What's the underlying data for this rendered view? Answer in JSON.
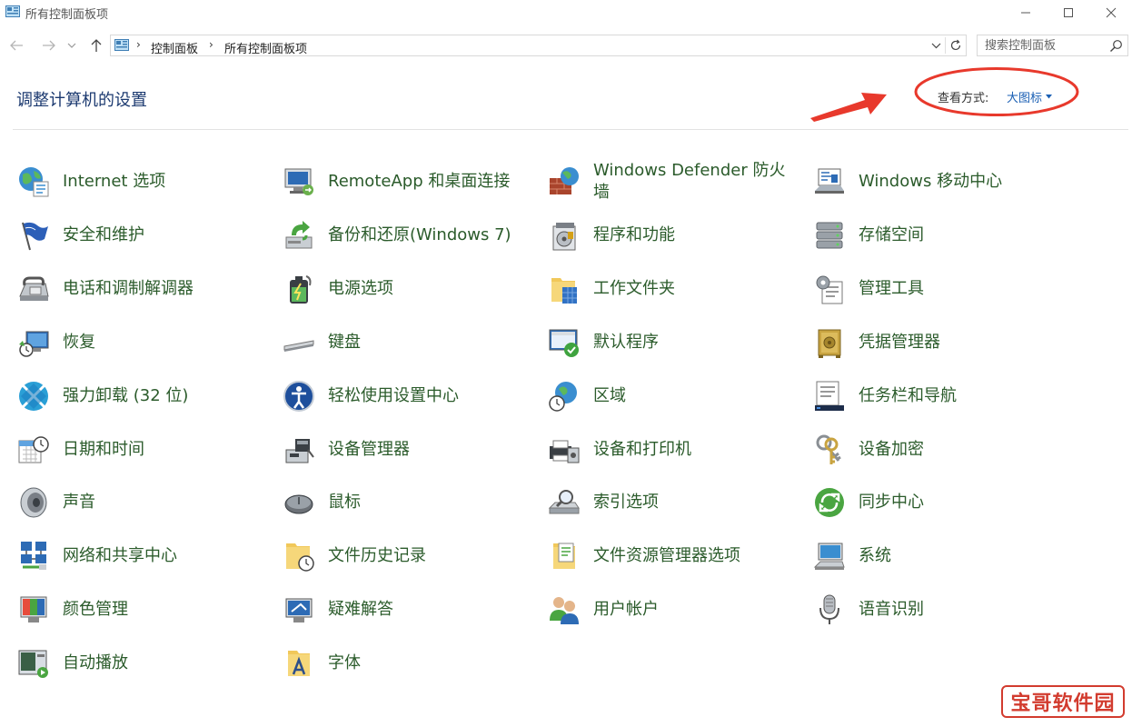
{
  "window": {
    "title": "所有控制面板项",
    "minimize_icon": "minimize-icon",
    "maximize_icon": "maximize-icon",
    "close_icon": "close-icon"
  },
  "nav": {
    "back_icon": "arrow-left-icon",
    "forward_icon": "arrow-right-icon",
    "recent_icon": "chevron-down-icon",
    "up_icon": "arrow-up-icon"
  },
  "address": {
    "location_icon": "control-panel-icon",
    "breadcrumbs": [
      "控制面板",
      "所有控制面板项"
    ],
    "refresh_icon": "refresh-icon"
  },
  "search": {
    "placeholder": "搜索控制面板",
    "icon": "search-icon"
  },
  "header": {
    "title": "调整计算机的设置",
    "view_by_label": "查看方式:",
    "view_by_value": "大图标"
  },
  "annotation": {
    "color": "#e8392c"
  },
  "colors": {
    "link_green": "#2b5b2b",
    "title_blue": "#1c3a70",
    "accent_blue": "#1a5fb4"
  },
  "items": [
    {
      "label": "Internet 选项",
      "icon": "globe-icon"
    },
    {
      "label": "RemoteApp 和桌面连接",
      "icon": "remote-desktop-icon"
    },
    {
      "label": "Windows Defender 防火墙",
      "icon": "firewall-icon"
    },
    {
      "label": "Windows 移动中心",
      "icon": "mobility-center-icon"
    },
    {
      "label": "安全和维护",
      "icon": "flag-icon"
    },
    {
      "label": "备份和还原(Windows 7)",
      "icon": "backup-icon"
    },
    {
      "label": "程序和功能",
      "icon": "programs-icon"
    },
    {
      "label": "存储空间",
      "icon": "storage-icon"
    },
    {
      "label": "电话和调制解调器",
      "icon": "phone-modem-icon"
    },
    {
      "label": "电源选项",
      "icon": "battery-icon"
    },
    {
      "label": "工作文件夹",
      "icon": "work-folders-icon"
    },
    {
      "label": "管理工具",
      "icon": "admin-tools-icon"
    },
    {
      "label": "恢复",
      "icon": "recovery-icon"
    },
    {
      "label": "键盘",
      "icon": "keyboard-icon"
    },
    {
      "label": "默认程序",
      "icon": "default-programs-icon"
    },
    {
      "label": "凭据管理器",
      "icon": "credential-vault-icon"
    },
    {
      "label": "强力卸载 (32 位)",
      "icon": "uninstaller-icon"
    },
    {
      "label": "轻松使用设置中心",
      "icon": "ease-of-access-icon"
    },
    {
      "label": "区域",
      "icon": "region-icon"
    },
    {
      "label": "任务栏和导航",
      "icon": "taskbar-icon"
    },
    {
      "label": "日期和时间",
      "icon": "calendar-clock-icon"
    },
    {
      "label": "设备管理器",
      "icon": "device-manager-icon"
    },
    {
      "label": "设备和打印机",
      "icon": "printer-icon"
    },
    {
      "label": "设备加密",
      "icon": "keys-icon"
    },
    {
      "label": "声音",
      "icon": "speaker-icon"
    },
    {
      "label": "鼠标",
      "icon": "mouse-icon"
    },
    {
      "label": "索引选项",
      "icon": "indexing-icon"
    },
    {
      "label": "同步中心",
      "icon": "sync-icon"
    },
    {
      "label": "网络和共享中心",
      "icon": "network-icon"
    },
    {
      "label": "文件历史记录",
      "icon": "file-history-icon"
    },
    {
      "label": "文件资源管理器选项",
      "icon": "folder-options-icon"
    },
    {
      "label": "系统",
      "icon": "system-icon"
    },
    {
      "label": "颜色管理",
      "icon": "color-management-icon"
    },
    {
      "label": "疑难解答",
      "icon": "troubleshooting-icon"
    },
    {
      "label": "用户帐户",
      "icon": "user-accounts-icon"
    },
    {
      "label": "语音识别",
      "icon": "microphone-icon"
    },
    {
      "label": "自动播放",
      "icon": "autoplay-icon"
    },
    {
      "label": "字体",
      "icon": "fonts-icon"
    }
  ],
  "watermark": {
    "text": "宝哥软件园"
  }
}
